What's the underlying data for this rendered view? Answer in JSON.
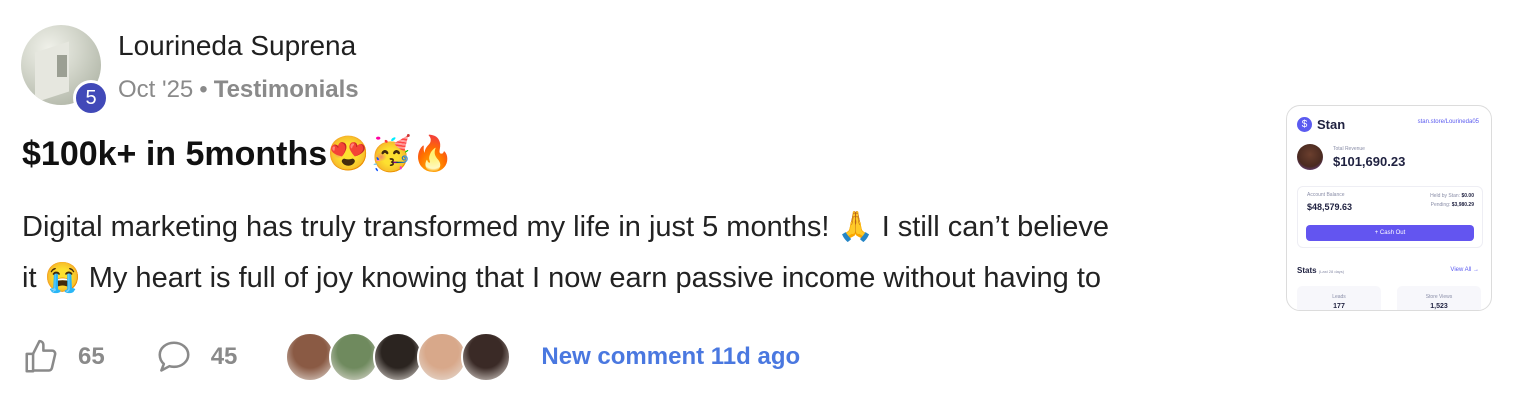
{
  "post": {
    "author": "Lourineda Suprena",
    "level": "5",
    "date": "Oct '25",
    "separator": "•",
    "category": "Testimonials",
    "title": "$100k+ in 5months😍🥳🔥",
    "body_line1": "Digital marketing has truly transformed my life in just 5 months! 🙏 I still can’t believe",
    "body_line2": "it 😭 My heart is full of joy knowing that I now earn passive income without having to"
  },
  "actions": {
    "like_icon": "thumbs-up-icon",
    "like_count": "65",
    "comment_icon": "comment-bubble-icon",
    "comment_count": "45",
    "new_comment": "New comment 11d ago"
  },
  "commenter_faces": [
    {
      "color": "#8a5a44"
    },
    {
      "color": "#6f8a5e"
    },
    {
      "color": "#2b2420"
    },
    {
      "color": "#d8a88a"
    },
    {
      "color": "#3a2a26"
    }
  ],
  "thumbnail": {
    "brand": "Stan",
    "brand_icon": "dollar-icon",
    "url": "stan.store/Lourineda05",
    "total_revenue_label": "Total Revenue",
    "total_revenue": "$101,690.23",
    "account_balance_label": "Account Balance",
    "account_balance": "$48,579.63",
    "held_label": "Held by Stan:",
    "held_value": "$0.00",
    "pending_label": "Pending:",
    "pending_value": "$3,980.29",
    "cash_out": "+ Cash Out",
    "stats_label": "Stats",
    "stats_period": "(Last 28 days)",
    "view_all": "View All →",
    "leads_label": "Leads",
    "leads_value": "177",
    "store_views_label": "Store Views",
    "store_views_value": "1,523"
  },
  "colors": {
    "level_badge": "#4149b8",
    "link": "#4a78e0",
    "stan_accent": "#6355f0"
  }
}
